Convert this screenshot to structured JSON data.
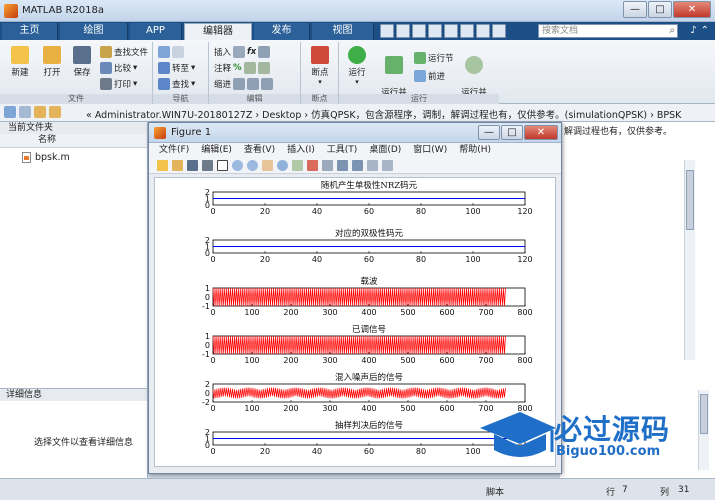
{
  "window": {
    "title": "MATLAB R2018a"
  },
  "tabs": [
    "主页",
    "绘图",
    "APP",
    "编辑器",
    "发布",
    "视图"
  ],
  "search": {
    "placeholder": "搜索文档"
  },
  "ribbon": {
    "new_label": "新建",
    "open_label": "打开",
    "save_label": "保存",
    "find_files_label": "查找文件",
    "compare_label": "比较",
    "print_label": "打印",
    "goto_label": "转至",
    "find_label": "查找",
    "insert_label": "插入",
    "comment_label": "注释",
    "indent_label": "缩进",
    "breakpoints_label": "断点",
    "run_label": "运行",
    "run_advance_label": "运行并\n前进",
    "run_section_label": "运行节",
    "advance_label": "前进",
    "run_time_label": "运行并\n计时",
    "groups": {
      "file": "文件",
      "nav": "导航",
      "edit": "编辑",
      "breakpoints": "断点",
      "run": "运行"
    }
  },
  "address": {
    "path": "« Administrator.WIN7U-20180127Z › Desktop › 仿真QPSK，包含源程序，调制，解调过程也有，仅供参考。(simulationQPSK) › BPSK"
  },
  "left_panel": {
    "title": "当前文件夹",
    "column": "名称",
    "file": "bpsk.m"
  },
  "details_panel": {
    "title": "详细信息",
    "message": "选择文件以查看详细信息"
  },
  "right_area": {
    "truncated": "解调过程也有，仅供参考。"
  },
  "status": {
    "mode": "脚本",
    "row_label": "行",
    "row": "7",
    "col_label": "列",
    "col": "31"
  },
  "figure": {
    "title": "Figure 1",
    "menu": [
      "文件(F)",
      "编辑(E)",
      "查看(V)",
      "插入(I)",
      "工具(T)",
      "桌面(D)",
      "窗口(W)",
      "帮助(H)"
    ]
  },
  "chart_data": [
    {
      "type": "line",
      "title": "随机产生单极性NRZ码元",
      "xlim": [
        0,
        120
      ],
      "ylim": [
        0,
        2
      ],
      "xticks": [
        "0",
        "20",
        "40",
        "60",
        "80",
        "100",
        "120"
      ],
      "yticks": [
        "2",
        "1",
        "0"
      ],
      "color": "#0000ff",
      "kind": "flat",
      "level": 1,
      "end": 120
    },
    {
      "type": "line",
      "title": "对应的双极性码元",
      "xlim": [
        0,
        120
      ],
      "ylim": [
        0,
        2
      ],
      "xticks": [
        "0",
        "20",
        "40",
        "60",
        "80",
        "100",
        "120"
      ],
      "yticks": [
        "2",
        "1",
        "0"
      ],
      "color": "#0000ff",
      "kind": "flat",
      "level": 1,
      "end": 120
    },
    {
      "type": "line",
      "title": "载波",
      "xlim": [
        0,
        800
      ],
      "ylim": [
        -1,
        1
      ],
      "xticks": [
        "0",
        "100",
        "200",
        "300",
        "400",
        "500",
        "600",
        "700",
        "800"
      ],
      "yticks": [
        "1",
        "0",
        "-1"
      ],
      "color": "#ff0000",
      "kind": "osc",
      "amp": 1,
      "end": 750
    },
    {
      "type": "line",
      "title": "已调信号",
      "xlim": [
        0,
        800
      ],
      "ylim": [
        -1,
        1
      ],
      "xticks": [
        "0",
        "100",
        "200",
        "300",
        "400",
        "500",
        "600",
        "700",
        "800"
      ],
      "yticks": [
        "1",
        "0",
        "-1"
      ],
      "color": "#ff0000",
      "kind": "osc",
      "amp": 1,
      "end": 750
    },
    {
      "type": "line",
      "title": "混入噪声后的信号",
      "xlim": [
        0,
        800
      ],
      "ylim": [
        -2,
        2
      ],
      "xticks": [
        "0",
        "100",
        "200",
        "300",
        "400",
        "500",
        "600",
        "700",
        "800"
      ],
      "yticks": [
        "2",
        "0",
        "-2"
      ],
      "color": "#ff0000",
      "kind": "noise",
      "amp": 1.2,
      "end": 750
    },
    {
      "type": "line",
      "title": "抽样判决后的信号",
      "xlim": [
        0,
        120
      ],
      "ylim": [
        0,
        2
      ],
      "xticks": [
        "0",
        "20",
        "40",
        "60",
        "80",
        "100",
        "120"
      ],
      "yticks": [
        "2",
        "1",
        "0"
      ],
      "color": "#0000ff",
      "kind": "flat",
      "level": 1,
      "end": 120
    }
  ],
  "watermark": {
    "text": "必过源码",
    "sub": "Biguo100.com"
  },
  "colors": {
    "tabbar": "#1c4f86",
    "accent": "#1f6fc8"
  }
}
